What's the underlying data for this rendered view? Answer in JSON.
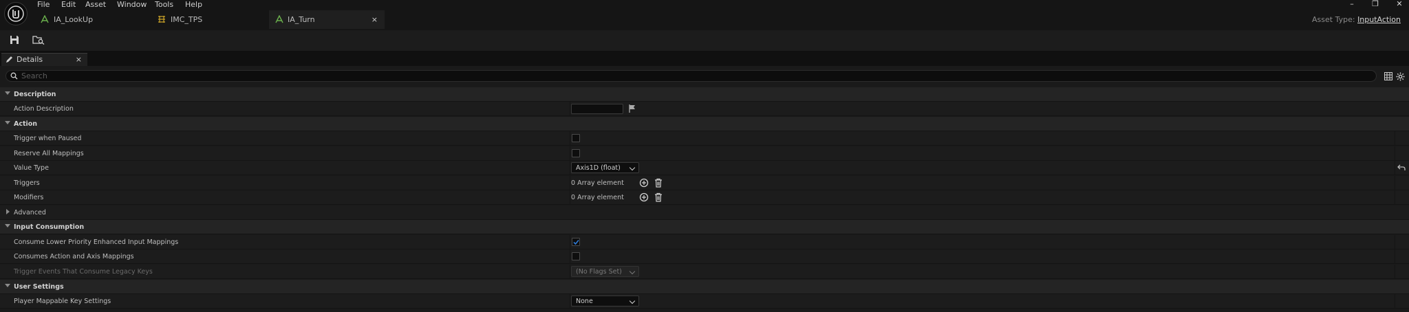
{
  "menu": [
    "File",
    "Edit",
    "Asset",
    "Window",
    "Tools",
    "Help"
  ],
  "tabs": [
    {
      "label": "IA_LookUp"
    },
    {
      "label": "IMC_TPS"
    },
    {
      "label": "IA_Turn",
      "close": "×"
    }
  ],
  "window_controls": {
    "minimize": "–",
    "restore": "❐",
    "close": "✕"
  },
  "asset_type": {
    "prefix": "Asset Type:",
    "value": "InputAction"
  },
  "details_tab": {
    "label": "Details",
    "close": "×"
  },
  "search": {
    "placeholder": "Search"
  },
  "rows": {
    "description": "Description",
    "action_description": "Action Description",
    "action": "Action",
    "trigger_when_paused": "Trigger when Paused",
    "reserve_all_mappings": "Reserve All Mappings",
    "value_type": "Value Type",
    "value_type_value": "Axis1D (float)",
    "triggers": "Triggers",
    "triggers_value": "0 Array element",
    "modifiers": "Modifiers",
    "modifiers_value": "0 Array element",
    "advanced": "Advanced",
    "input_consumption": "Input Consumption",
    "consume_lower": "Consume Lower Priority Enhanced Input Mappings",
    "consumes_action_axis": "Consumes Action and Axis Mappings",
    "trigger_events_legacy": "Trigger Events That Consume Legacy Keys",
    "trigger_events_legacy_value": "(No Flags Set)",
    "user_settings": "User Settings",
    "player_mappable": "Player Mappable Key Settings",
    "player_mappable_value": "None"
  },
  "checkboxes": {
    "trigger_when_paused": false,
    "reserve_all_mappings": false,
    "consume_lower": true,
    "consumes_action_axis": false
  },
  "colors": {
    "accent": "#2f7bd6",
    "background": "#1a1a1a"
  }
}
